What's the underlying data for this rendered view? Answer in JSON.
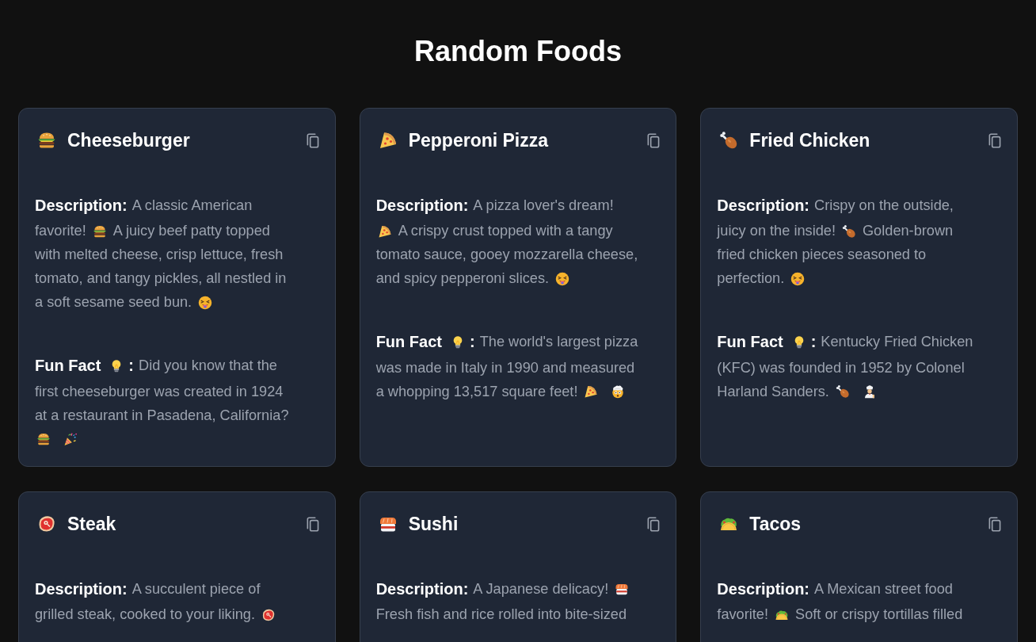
{
  "page_title": "Random Foods",
  "cards": [
    {
      "icon": {
        "kind": "burger"
      },
      "title": "Cheeseburger",
      "sections": [
        {
          "lines": [
            {
              "segments": [
                {
                  "kind": "label",
                  "text": "Description:"
                },
                {
                  "kind": "text",
                  "text": "A classic American"
                }
              ]
            },
            {
              "segments": [
                {
                  "kind": "text",
                  "text": "favorite!"
                },
                {
                  "kind": "burger"
                },
                {
                  "kind": "text",
                  "text": "A juicy beef patty topped"
                }
              ]
            },
            {
              "segments": [
                {
                  "kind": "text",
                  "text": "with melted cheese, crisp lettuce, fresh"
                }
              ]
            },
            {
              "segments": [
                {
                  "kind": "text",
                  "text": "tomato, and tangy pickles, all nestled in"
                }
              ]
            },
            {
              "segments": [
                {
                  "kind": "text",
                  "text": "a soft sesame seed bun."
                },
                {
                  "kind": "yum"
                }
              ]
            }
          ]
        },
        {
          "lines": [
            {
              "segments": [
                {
                  "kind": "label",
                  "text": "Fun Fact"
                },
                {
                  "kind": "bulb"
                },
                {
                  "kind": "label",
                  "text": ":"
                },
                {
                  "kind": "text",
                  "text": "Did you know that the"
                }
              ]
            },
            {
              "segments": [
                {
                  "kind": "text",
                  "text": "first cheeseburger was created in 1924"
                }
              ]
            },
            {
              "segments": [
                {
                  "kind": "text",
                  "text": "at a restaurant in Pasadena, California?"
                }
              ]
            },
            {
              "segments": [
                {
                  "kind": "burger"
                },
                {
                  "kind": "party"
                }
              ]
            }
          ]
        }
      ]
    },
    {
      "icon": {
        "kind": "pizza"
      },
      "title": "Pepperoni Pizza",
      "sections": [
        {
          "lines": [
            {
              "segments": [
                {
                  "kind": "label",
                  "text": "Description:"
                },
                {
                  "kind": "text",
                  "text": "A pizza lover's dream!"
                }
              ]
            },
            {
              "segments": [
                {
                  "kind": "pizza"
                },
                {
                  "kind": "text",
                  "text": "A crispy crust topped with a tangy"
                }
              ]
            },
            {
              "segments": [
                {
                  "kind": "text",
                  "text": "tomato sauce, gooey mozzarella cheese,"
                }
              ]
            },
            {
              "segments": [
                {
                  "kind": "text",
                  "text": "and spicy pepperoni slices."
                },
                {
                  "kind": "yum"
                }
              ]
            }
          ]
        },
        {
          "lines": [
            {
              "segments": [
                {
                  "kind": "label",
                  "text": "Fun Fact"
                },
                {
                  "kind": "bulb"
                },
                {
                  "kind": "label",
                  "text": ":"
                },
                {
                  "kind": "text",
                  "text": "The world's largest pizza"
                }
              ]
            },
            {
              "segments": [
                {
                  "kind": "text",
                  "text": "was made in Italy in 1990 and measured"
                }
              ]
            },
            {
              "segments": [
                {
                  "kind": "text",
                  "text": "a whopping 13,517 square feet!"
                },
                {
                  "kind": "pizza"
                },
                {
                  "kind": "mindblown"
                }
              ]
            }
          ]
        }
      ]
    },
    {
      "icon": {
        "kind": "drumstick"
      },
      "title": "Fried Chicken",
      "sections": [
        {
          "lines": [
            {
              "segments": [
                {
                  "kind": "label",
                  "text": "Description:"
                },
                {
                  "kind": "text",
                  "text": "Crispy on the outside,"
                }
              ]
            },
            {
              "segments": [
                {
                  "kind": "text",
                  "text": "juicy on the inside!"
                },
                {
                  "kind": "drumstick"
                },
                {
                  "kind": "text",
                  "text": "Golden-brown"
                }
              ]
            },
            {
              "segments": [
                {
                  "kind": "text",
                  "text": "fried chicken pieces seasoned to"
                }
              ]
            },
            {
              "segments": [
                {
                  "kind": "text",
                  "text": "perfection."
                },
                {
                  "kind": "yum"
                }
              ]
            }
          ]
        },
        {
          "lines": [
            {
              "segments": [
                {
                  "kind": "label",
                  "text": "Fun Fact"
                },
                {
                  "kind": "bulb"
                },
                {
                  "kind": "label",
                  "text": ":"
                },
                {
                  "kind": "text",
                  "text": "Kentucky Fried Chicken"
                }
              ]
            },
            {
              "segments": [
                {
                  "kind": "text",
                  "text": "(KFC) was founded in 1952 by Colonel"
                }
              ]
            },
            {
              "segments": [
                {
                  "kind": "text",
                  "text": "Harland Sanders."
                },
                {
                  "kind": "drumstick"
                },
                {
                  "kind": "chef"
                }
              ]
            }
          ]
        }
      ]
    },
    {
      "icon": {
        "kind": "steak"
      },
      "title": "Steak",
      "sections": [
        {
          "lines": [
            {
              "segments": [
                {
                  "kind": "label",
                  "text": "Description:"
                },
                {
                  "kind": "text",
                  "text": "A succulent piece of"
                }
              ]
            },
            {
              "segments": [
                {
                  "kind": "text",
                  "text": "grilled steak, cooked to your liking."
                },
                {
                  "kind": "steak"
                }
              ]
            }
          ]
        }
      ]
    },
    {
      "icon": {
        "kind": "sushi"
      },
      "title": "Sushi",
      "sections": [
        {
          "lines": [
            {
              "segments": [
                {
                  "kind": "label",
                  "text": "Description:"
                },
                {
                  "kind": "text",
                  "text": "A Japanese delicacy!"
                },
                {
                  "kind": "sushi"
                }
              ]
            },
            {
              "segments": [
                {
                  "kind": "text",
                  "text": "Fresh fish and rice rolled into bite-sized"
                }
              ]
            }
          ]
        }
      ]
    },
    {
      "icon": {
        "kind": "taco"
      },
      "title": "Tacos",
      "sections": [
        {
          "lines": [
            {
              "segments": [
                {
                  "kind": "label",
                  "text": "Description:"
                },
                {
                  "kind": "text",
                  "text": "A Mexican street food"
                }
              ]
            },
            {
              "segments": [
                {
                  "kind": "text",
                  "text": "favorite!"
                },
                {
                  "kind": "taco"
                },
                {
                  "kind": "text",
                  "text": "Soft or crispy tortillas filled"
                }
              ]
            }
          ]
        }
      ]
    }
  ]
}
